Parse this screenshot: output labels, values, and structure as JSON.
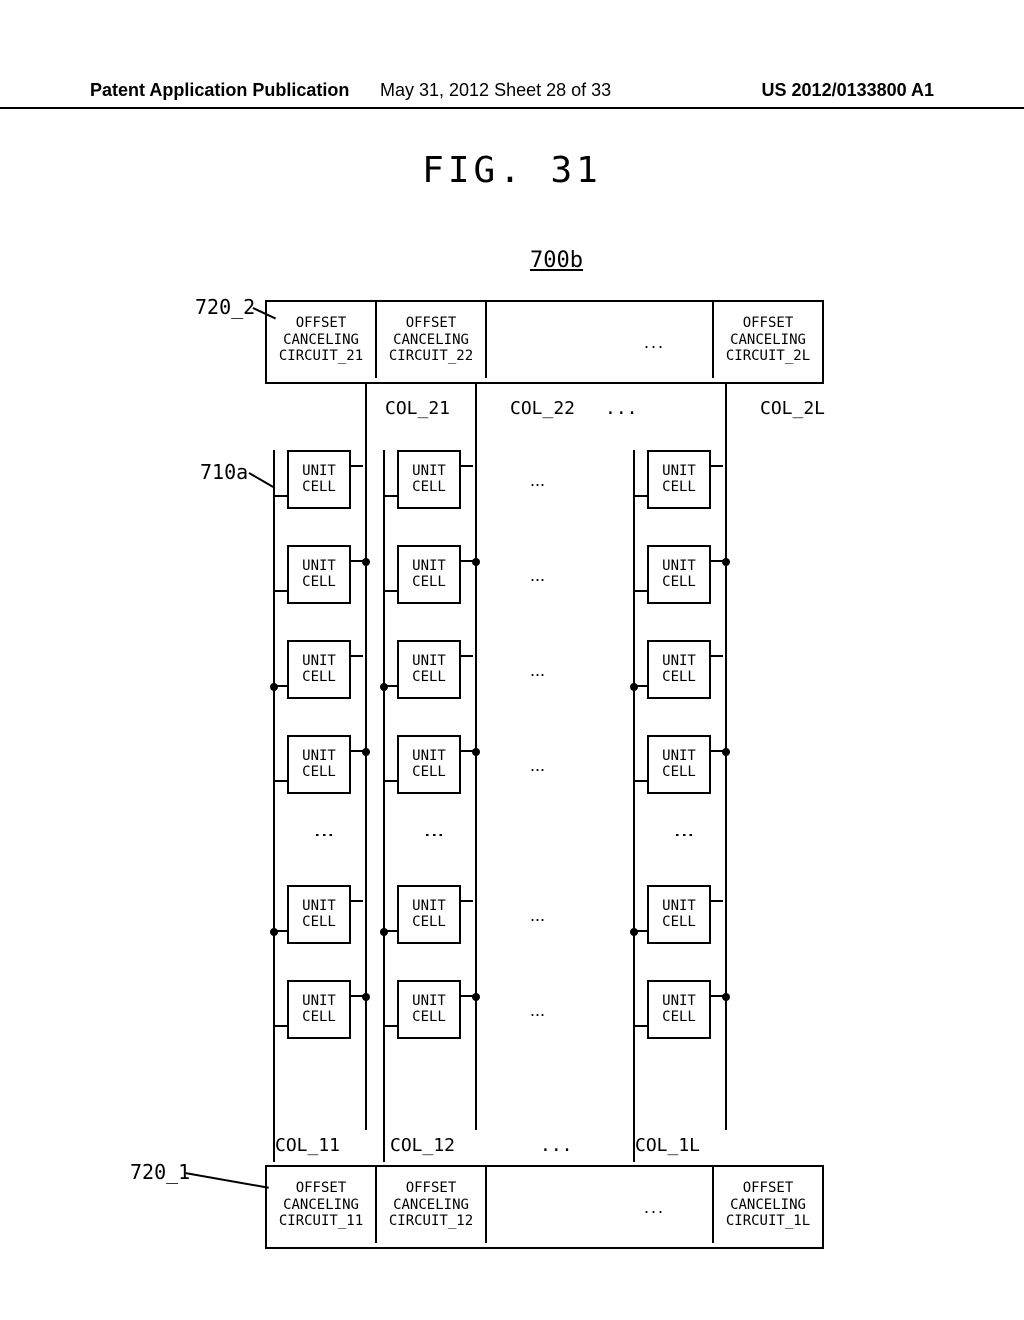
{
  "header": {
    "left": "Patent Application Publication",
    "center": "May 31, 2012  Sheet 28 of 33",
    "right": "US 2012/0133800 A1"
  },
  "figure": {
    "title": "FIG. 31",
    "ref": "700b"
  },
  "callouts": {
    "c720_2": "720_2",
    "c710a": "710a",
    "c720_1": "720_1"
  },
  "occ": {
    "offset": "OFFSET",
    "canceling": "CANCELING",
    "top": {
      "c1": "CIRCUIT_21",
      "c2": "CIRCUIT_22",
      "cL": "CIRCUIT_2L"
    },
    "bot": {
      "c1": "CIRCUIT_11",
      "c2": "CIRCUIT_12",
      "cL": "CIRCUIT_1L"
    }
  },
  "col_labels": {
    "top": {
      "c1": "COL_21",
      "c2": "COL_22",
      "cL": "COL_2L"
    },
    "bot": {
      "c1": "COL_11",
      "c2": "COL_12",
      "cL": "COL_1L"
    }
  },
  "cell": {
    "l1": "UNIT",
    "l2": "CELL"
  },
  "dots": "...",
  "vdots": "⋮"
}
